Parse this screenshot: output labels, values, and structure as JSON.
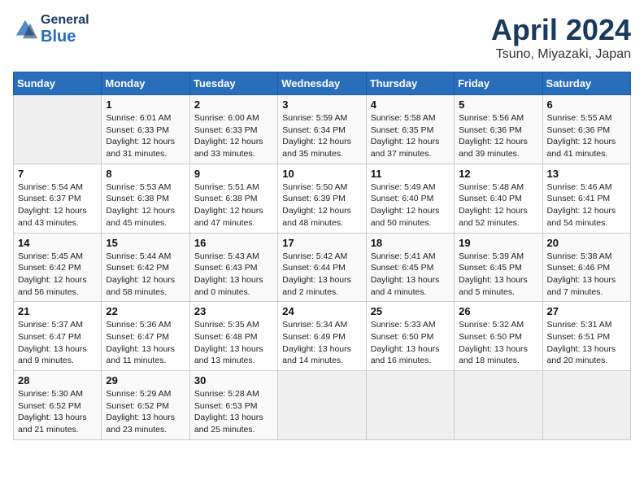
{
  "header": {
    "logo_line1": "General",
    "logo_line2": "Blue",
    "month_title": "April 2024",
    "location": "Tsuno, Miyazaki, Japan"
  },
  "weekdays": [
    "Sunday",
    "Monday",
    "Tuesday",
    "Wednesday",
    "Thursday",
    "Friday",
    "Saturday"
  ],
  "weeks": [
    [
      {
        "num": "",
        "info": ""
      },
      {
        "num": "1",
        "info": "Sunrise: 6:01 AM\nSunset: 6:33 PM\nDaylight: 12 hours\nand 31 minutes."
      },
      {
        "num": "2",
        "info": "Sunrise: 6:00 AM\nSunset: 6:33 PM\nDaylight: 12 hours\nand 33 minutes."
      },
      {
        "num": "3",
        "info": "Sunrise: 5:59 AM\nSunset: 6:34 PM\nDaylight: 12 hours\nand 35 minutes."
      },
      {
        "num": "4",
        "info": "Sunrise: 5:58 AM\nSunset: 6:35 PM\nDaylight: 12 hours\nand 37 minutes."
      },
      {
        "num": "5",
        "info": "Sunrise: 5:56 AM\nSunset: 6:36 PM\nDaylight: 12 hours\nand 39 minutes."
      },
      {
        "num": "6",
        "info": "Sunrise: 5:55 AM\nSunset: 6:36 PM\nDaylight: 12 hours\nand 41 minutes."
      }
    ],
    [
      {
        "num": "7",
        "info": "Sunrise: 5:54 AM\nSunset: 6:37 PM\nDaylight: 12 hours\nand 43 minutes."
      },
      {
        "num": "8",
        "info": "Sunrise: 5:53 AM\nSunset: 6:38 PM\nDaylight: 12 hours\nand 45 minutes."
      },
      {
        "num": "9",
        "info": "Sunrise: 5:51 AM\nSunset: 6:38 PM\nDaylight: 12 hours\nand 47 minutes."
      },
      {
        "num": "10",
        "info": "Sunrise: 5:50 AM\nSunset: 6:39 PM\nDaylight: 12 hours\nand 48 minutes."
      },
      {
        "num": "11",
        "info": "Sunrise: 5:49 AM\nSunset: 6:40 PM\nDaylight: 12 hours\nand 50 minutes."
      },
      {
        "num": "12",
        "info": "Sunrise: 5:48 AM\nSunset: 6:40 PM\nDaylight: 12 hours\nand 52 minutes."
      },
      {
        "num": "13",
        "info": "Sunrise: 5:46 AM\nSunset: 6:41 PM\nDaylight: 12 hours\nand 54 minutes."
      }
    ],
    [
      {
        "num": "14",
        "info": "Sunrise: 5:45 AM\nSunset: 6:42 PM\nDaylight: 12 hours\nand 56 minutes."
      },
      {
        "num": "15",
        "info": "Sunrise: 5:44 AM\nSunset: 6:42 PM\nDaylight: 12 hours\nand 58 minutes."
      },
      {
        "num": "16",
        "info": "Sunrise: 5:43 AM\nSunset: 6:43 PM\nDaylight: 13 hours\nand 0 minutes."
      },
      {
        "num": "17",
        "info": "Sunrise: 5:42 AM\nSunset: 6:44 PM\nDaylight: 13 hours\nand 2 minutes."
      },
      {
        "num": "18",
        "info": "Sunrise: 5:41 AM\nSunset: 6:45 PM\nDaylight: 13 hours\nand 4 minutes."
      },
      {
        "num": "19",
        "info": "Sunrise: 5:39 AM\nSunset: 6:45 PM\nDaylight: 13 hours\nand 5 minutes."
      },
      {
        "num": "20",
        "info": "Sunrise: 5:38 AM\nSunset: 6:46 PM\nDaylight: 13 hours\nand 7 minutes."
      }
    ],
    [
      {
        "num": "21",
        "info": "Sunrise: 5:37 AM\nSunset: 6:47 PM\nDaylight: 13 hours\nand 9 minutes."
      },
      {
        "num": "22",
        "info": "Sunrise: 5:36 AM\nSunset: 6:47 PM\nDaylight: 13 hours\nand 11 minutes."
      },
      {
        "num": "23",
        "info": "Sunrise: 5:35 AM\nSunset: 6:48 PM\nDaylight: 13 hours\nand 13 minutes."
      },
      {
        "num": "24",
        "info": "Sunrise: 5:34 AM\nSunset: 6:49 PM\nDaylight: 13 hours\nand 14 minutes."
      },
      {
        "num": "25",
        "info": "Sunrise: 5:33 AM\nSunset: 6:50 PM\nDaylight: 13 hours\nand 16 minutes."
      },
      {
        "num": "26",
        "info": "Sunrise: 5:32 AM\nSunset: 6:50 PM\nDaylight: 13 hours\nand 18 minutes."
      },
      {
        "num": "27",
        "info": "Sunrise: 5:31 AM\nSunset: 6:51 PM\nDaylight: 13 hours\nand 20 minutes."
      }
    ],
    [
      {
        "num": "28",
        "info": "Sunrise: 5:30 AM\nSunset: 6:52 PM\nDaylight: 13 hours\nand 21 minutes."
      },
      {
        "num": "29",
        "info": "Sunrise: 5:29 AM\nSunset: 6:52 PM\nDaylight: 13 hours\nand 23 minutes."
      },
      {
        "num": "30",
        "info": "Sunrise: 5:28 AM\nSunset: 6:53 PM\nDaylight: 13 hours\nand 25 minutes."
      },
      {
        "num": "",
        "info": ""
      },
      {
        "num": "",
        "info": ""
      },
      {
        "num": "",
        "info": ""
      },
      {
        "num": "",
        "info": ""
      }
    ]
  ]
}
